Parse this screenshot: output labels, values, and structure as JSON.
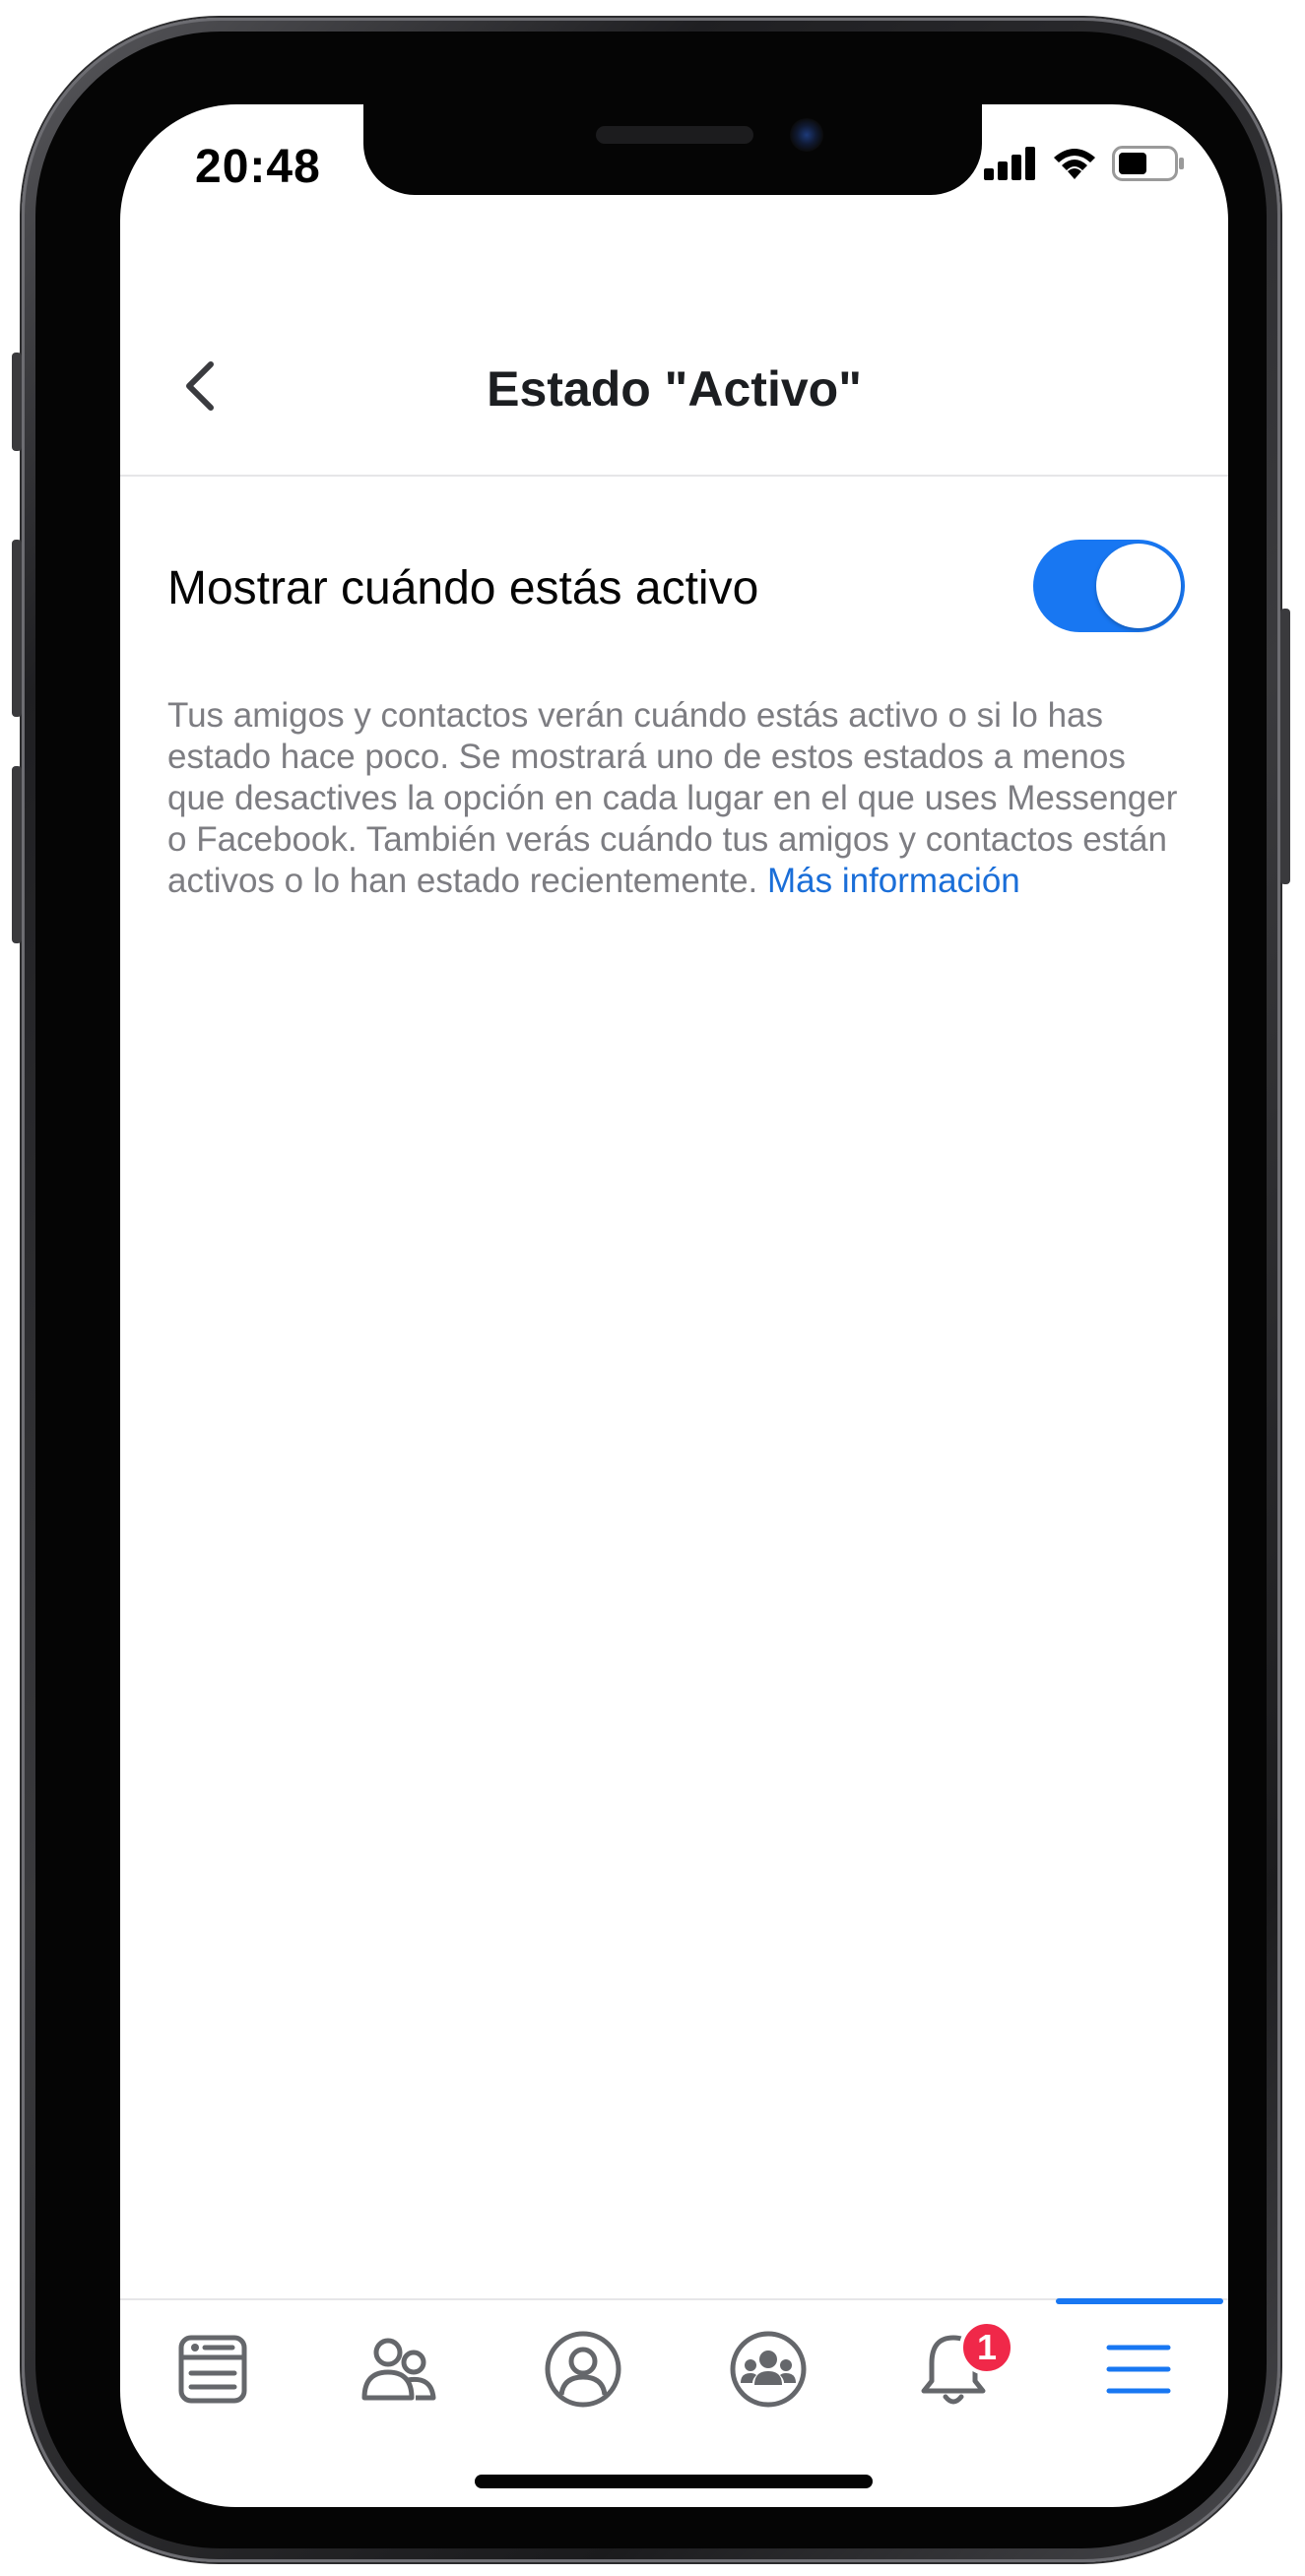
{
  "status_bar": {
    "time": "20:48"
  },
  "header": {
    "title": "Estado \"Activo\"",
    "back_icon": "chevron-left-icon"
  },
  "setting": {
    "label": "Mostrar cuándo estás activo",
    "enabled": true
  },
  "description": {
    "text": "Tus amigos y contactos verán cuándo estás activo o si lo has estado hace poco. Se mostrará uno de estos estados a menos que desactives la opción en cada lugar en el que uses Messenger o Facebook. También verás cuándo tus amigos y contactos están activos o lo han estado recientemente.",
    "link": "Más información"
  },
  "tab_bar": {
    "tabs": [
      {
        "icon": "news-feed-icon"
      },
      {
        "icon": "friends-icon"
      },
      {
        "icon": "profile-icon"
      },
      {
        "icon": "groups-icon"
      },
      {
        "icon": "notifications-bell-icon",
        "badge": "1"
      },
      {
        "icon": "menu-icon",
        "active": true
      }
    ]
  },
  "colors": {
    "accent": "#1877f2",
    "badge": "#f02849",
    "link": "#1a6ed8",
    "secondary_text": "#7d7d82"
  }
}
